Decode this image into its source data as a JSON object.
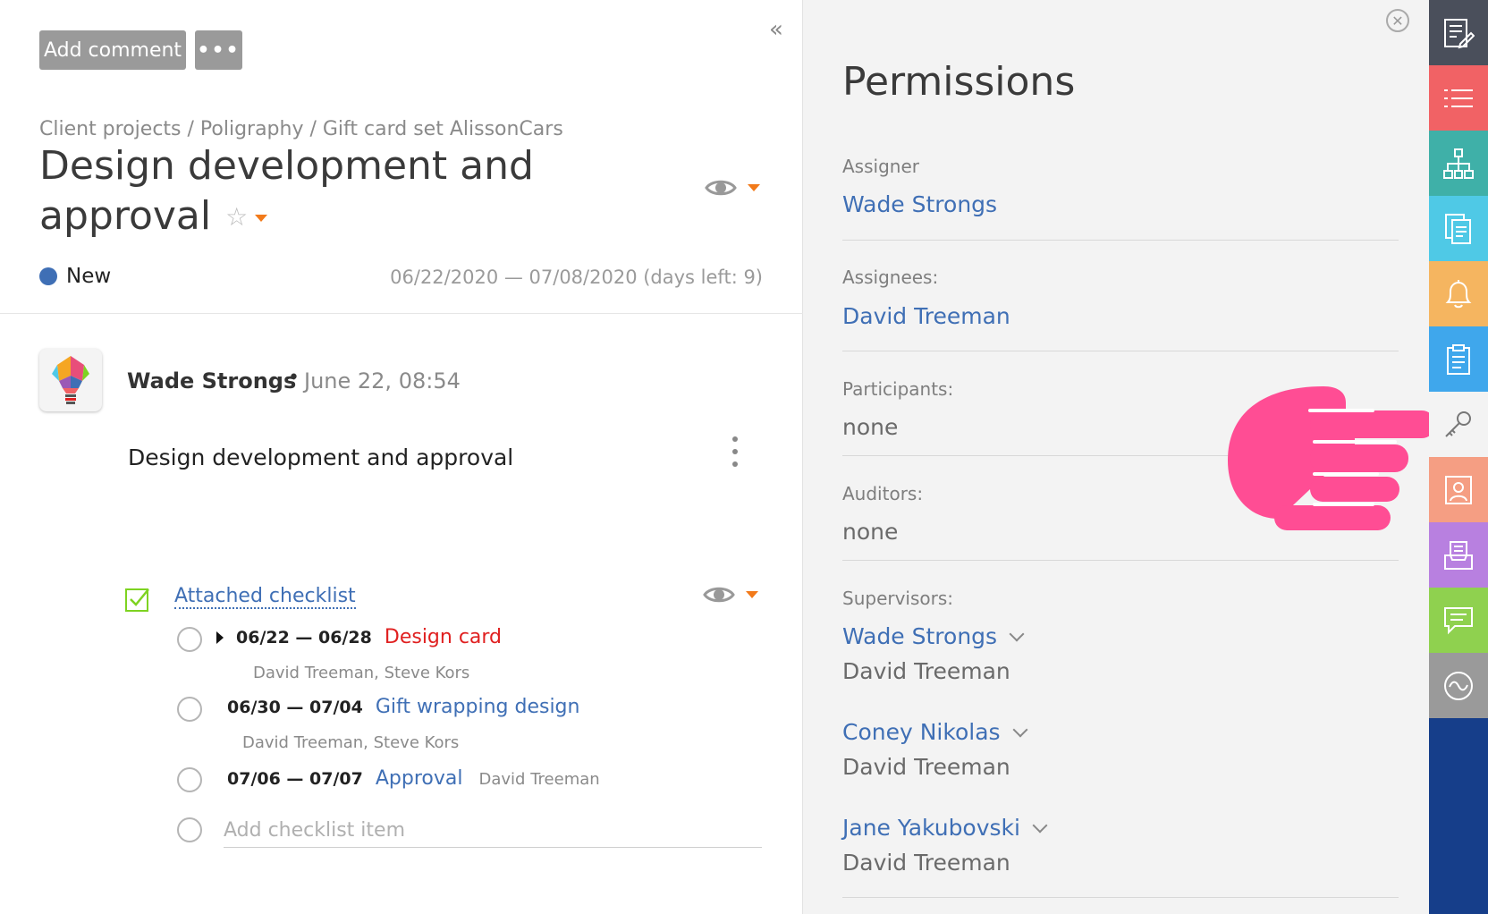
{
  "toolbar": {
    "add_comment_label": "Add comment",
    "more_label": "•••",
    "collapse_icon": "«"
  },
  "task": {
    "breadcrumb": "Client projects / Poligraphy / Gift card set AlissonCars",
    "title": "Design development and approval",
    "status": "New",
    "status_color": "#3f6fb5",
    "dates": "06/22/2020 — 07/08/2020 (days left: 9)"
  },
  "comment": {
    "author": "Wade Strongs",
    "bullet": "•",
    "date": "June 22, 08:54",
    "text": "Design development and approval"
  },
  "checklist": {
    "title": "Attached checklist",
    "items": [
      {
        "dates": "06/22 — 06/28",
        "name": "Design card",
        "assignees": "David Treeman, Steve Kors",
        "color": "#e02020"
      },
      {
        "dates": "06/30 — 07/04",
        "name": "Gift wrapping design",
        "assignees": "David Treeman, Steve Kors",
        "color": "#3f6fb5"
      },
      {
        "dates": "07/06 — 07/07",
        "name": "Approval",
        "assignees": "David Treeman",
        "color": "#3f6fb5"
      }
    ],
    "add_placeholder": "Add checklist item"
  },
  "permissions": {
    "title": "Permissions",
    "assigner_label": "Assigner",
    "assigner": "Wade Strongs",
    "assignees_label": "Assignees:",
    "assignees": "David Treeman",
    "participants_label": "Participants:",
    "participants": "none",
    "auditors_label": "Auditors:",
    "auditors": "none",
    "supervisors_label": "Supervisors:",
    "supervisors": [
      {
        "name": "Wade Strongs",
        "sub": "David Treeman"
      },
      {
        "name": "Coney Nikolas",
        "sub": "David Treeman"
      },
      {
        "name": "Jane Yakubovski",
        "sub": "David Treeman"
      }
    ]
  },
  "sidebar_icons": [
    {
      "icon": "edit-list-icon",
      "color": "#4a4f5b"
    },
    {
      "icon": "list-icon",
      "color": "#f16265"
    },
    {
      "icon": "hierarchy-icon",
      "color": "#3fb0a8"
    },
    {
      "icon": "documents-icon",
      "color": "#4fc9e6"
    },
    {
      "icon": "bell-icon",
      "color": "#f5b560"
    },
    {
      "icon": "clipboard-icon",
      "color": "#3fa7ec"
    },
    {
      "icon": "key-icon",
      "color": "#f3f3f3"
    },
    {
      "icon": "contact-icon",
      "color": "#f59e83"
    },
    {
      "icon": "inbox-icon",
      "color": "#b880e0"
    },
    {
      "icon": "chat-icon",
      "color": "#8fd14f"
    },
    {
      "icon": "activity-icon",
      "color": "#9a9a9a"
    }
  ]
}
